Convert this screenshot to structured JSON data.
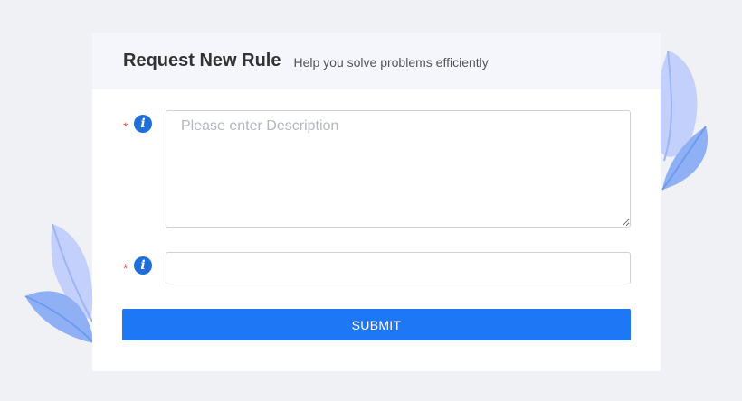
{
  "header": {
    "title": "Request New Rule",
    "subtitle": "Help you solve problems efficiently"
  },
  "form": {
    "description": {
      "required_mark": "*",
      "info_icon_glyph": "i",
      "placeholder": "Please enter Description",
      "value": ""
    },
    "second_field": {
      "required_mark": "*",
      "info_icon_glyph": "i",
      "placeholder": "",
      "value": ""
    },
    "submit_label": "SUBMIT"
  },
  "colors": {
    "accent": "#1e77f5",
    "info_icon": "#1e6fd9",
    "required": "#e8574f",
    "page_background": "#f0f1f5",
    "header_background": "#f4f6fb",
    "leaf_light": "#c3d0fb",
    "leaf_mid": "#9bb5f7",
    "leaf_dark": "#6e9af0"
  },
  "icons": [
    "info-icon",
    "info-icon",
    "leaf-decoration",
    "leaf-decoration"
  ]
}
